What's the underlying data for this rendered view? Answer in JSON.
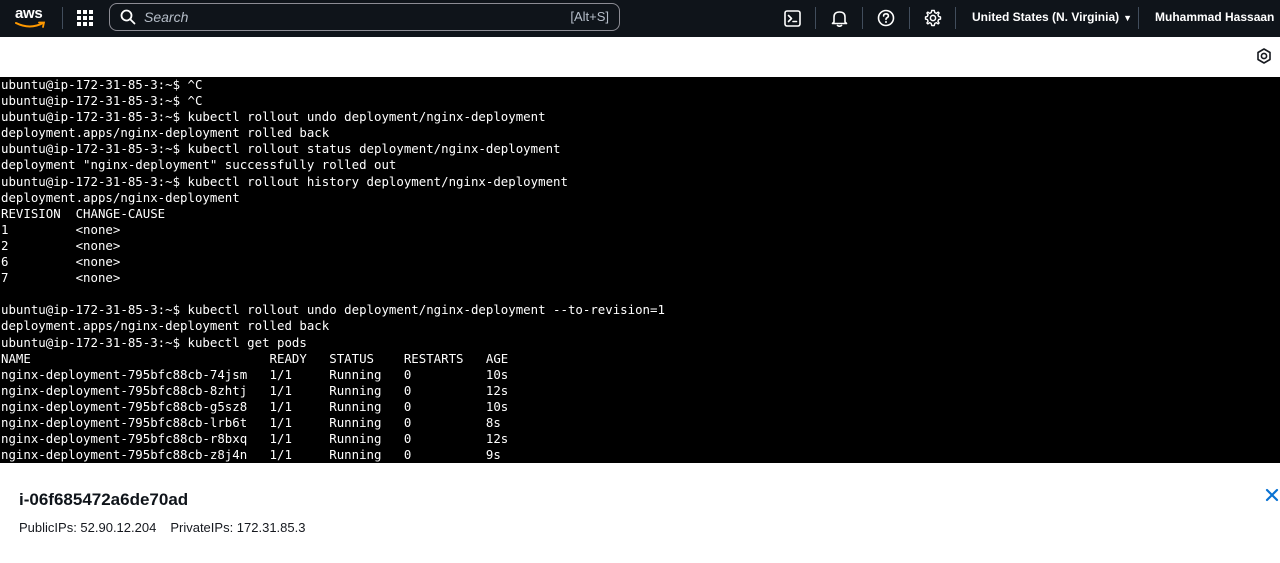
{
  "nav": {
    "logo_text": "aws",
    "search_placeholder": "Search",
    "search_shortcut": "[Alt+S]",
    "region": "United States (N. Virginia)",
    "user": "Muhammad Hassaan",
    "icons": [
      "grid-icon",
      "search-icon",
      "cloudshell-icon",
      "bell-icon",
      "help-icon",
      "gear-icon",
      "caret-down-icon"
    ]
  },
  "terminal": {
    "lines": [
      "ubuntu@ip-172-31-85-3:~$ ^C",
      "ubuntu@ip-172-31-85-3:~$ ^C",
      "ubuntu@ip-172-31-85-3:~$ kubectl rollout undo deployment/nginx-deployment",
      "deployment.apps/nginx-deployment rolled back",
      "ubuntu@ip-172-31-85-3:~$ kubectl rollout status deployment/nginx-deployment",
      "deployment \"nginx-deployment\" successfully rolled out",
      "ubuntu@ip-172-31-85-3:~$ kubectl rollout history deployment/nginx-deployment",
      "deployment.apps/nginx-deployment",
      "REVISION  CHANGE-CAUSE",
      "1         <none>",
      "2         <none>",
      "6         <none>",
      "7         <none>",
      "",
      "ubuntu@ip-172-31-85-3:~$ kubectl rollout undo deployment/nginx-deployment --to-revision=1",
      "deployment.apps/nginx-deployment rolled back",
      "ubuntu@ip-172-31-85-3:~$ kubectl get pods",
      "NAME                                READY   STATUS    RESTARTS   AGE",
      "nginx-deployment-795bfc88cb-74jsm   1/1     Running   0          10s",
      "nginx-deployment-795bfc88cb-8zhtj   1/1     Running   0          12s",
      "nginx-deployment-795bfc88cb-g5sz8   1/1     Running   0          10s",
      "nginx-deployment-795bfc88cb-lrb6t   1/1     Running   0          8s",
      "nginx-deployment-795bfc88cb-r8bxq   1/1     Running   0          12s",
      "nginx-deployment-795bfc88cb-z8j4n   1/1     Running   0          9s"
    ]
  },
  "instance": {
    "id": "i-06f685472a6de70ad",
    "public_ips_label": "PublicIPs: 52.90.12.204",
    "private_ips_label": "PrivateIPs: 172.31.85.3"
  },
  "colors": {
    "nav_bg": "#0f141a",
    "terminal_bg": "#000000",
    "terminal_fg": "#ffffff",
    "close_icon": "#0972d3"
  }
}
